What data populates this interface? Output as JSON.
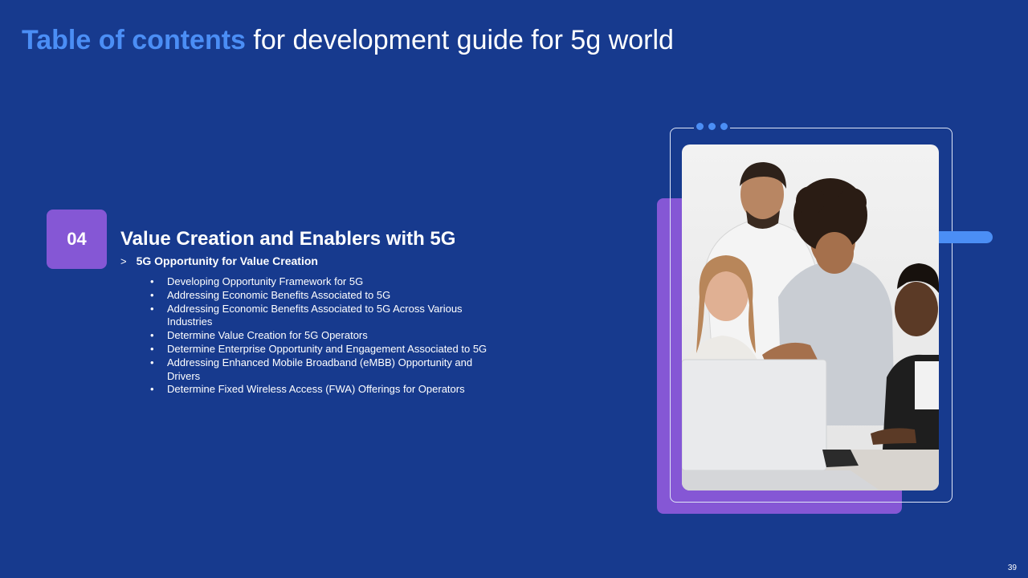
{
  "header": {
    "title_accent": "Table of contents",
    "title_rest": " for development guide for 5g world"
  },
  "section": {
    "number": "04",
    "title": "Value Creation and Enablers with 5G",
    "chevron": ">",
    "subheading": "5G Opportunity for Value Creation",
    "bullet_symbol": "•",
    "items": [
      "Developing Opportunity Framework for 5G",
      "Addressing Economic Benefits Associated to 5G",
      "Addressing Economic Benefits Associated to 5G Across Various Industries",
      "Determine Value Creation for 5G Operators",
      "Determine Enterprise Opportunity and Engagement Associated to 5G",
      "Addressing Enhanced Mobile Broadband (eMBB) Opportunity and Drivers",
      "Determine Fixed Wireless Access (FWA) Offerings for Operators"
    ]
  },
  "image": {
    "icon": "team-photo-icon"
  },
  "footer": {
    "page_number": "39"
  },
  "colors": {
    "background": "#173a8e",
    "accent_blue": "#4b8ef5",
    "accent_purple": "#8557d5",
    "text": "#ffffff"
  }
}
